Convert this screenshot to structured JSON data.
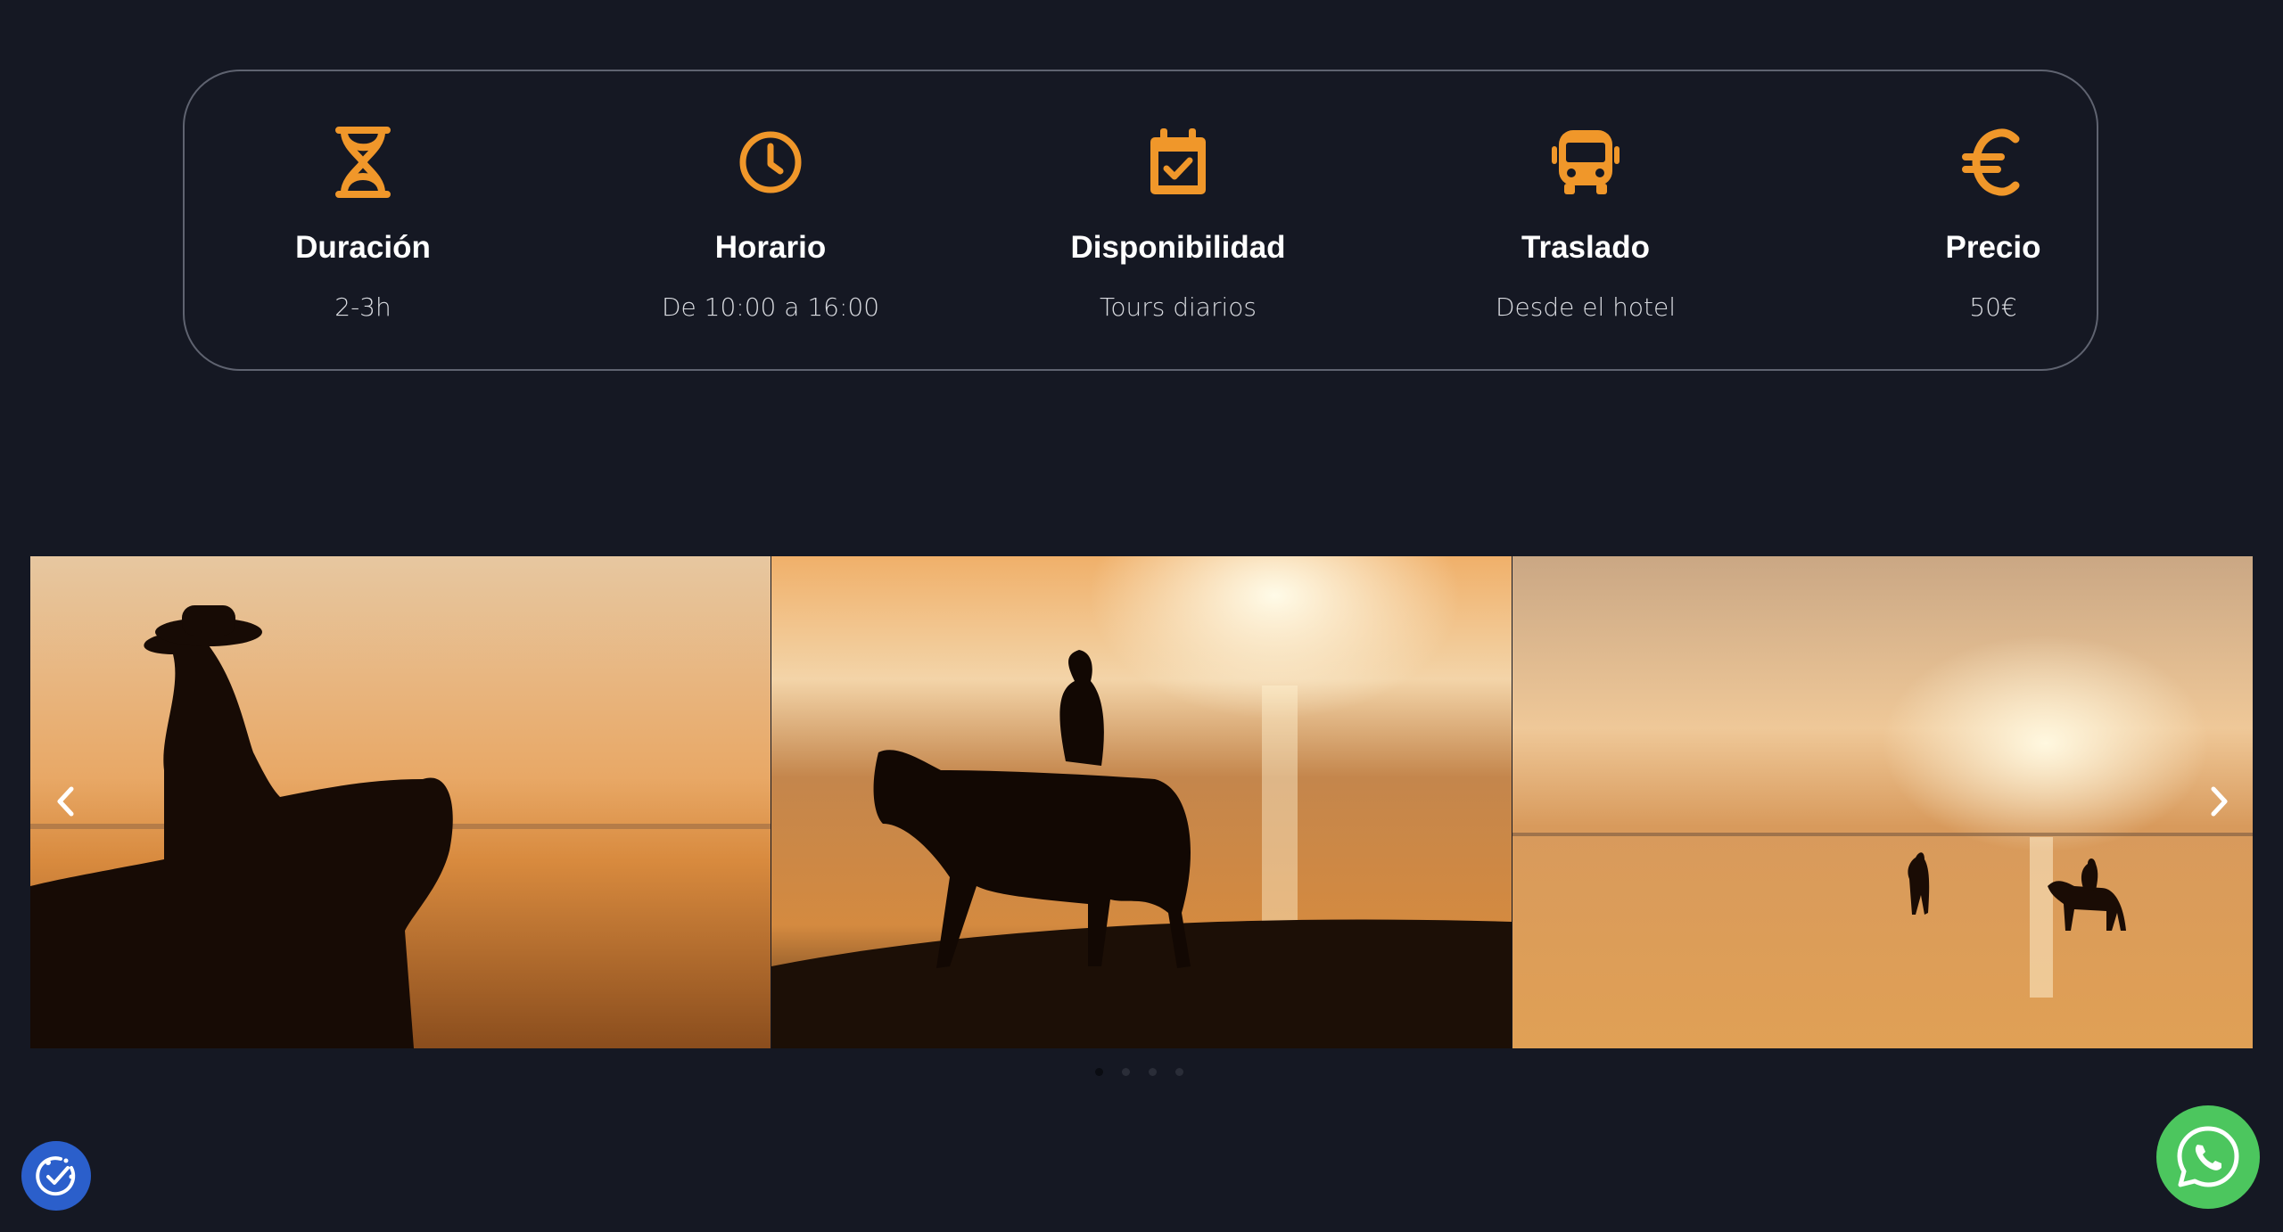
{
  "info": {
    "items": [
      {
        "icon": "hourglass-icon",
        "title": "Duración",
        "value": "2-3h"
      },
      {
        "icon": "clock-icon",
        "title": "Horario",
        "value": "De 10:00 a 16:00"
      },
      {
        "icon": "calendar-check-icon",
        "title": "Disponibilidad",
        "value": "Tours diarios"
      },
      {
        "icon": "bus-icon",
        "title": "Traslado",
        "value": "Desde el hotel"
      },
      {
        "icon": "euro-icon",
        "title": "Precio",
        "value": "50€"
      }
    ]
  },
  "carousel": {
    "slides": [
      {
        "image": "rider-with-hat-silhouette-sunset-beach"
      },
      {
        "image": "woman-riding-horse-silhouette-shoreline"
      },
      {
        "image": "distant-rider-and-walker-sunset-sea"
      }
    ],
    "dots_total": 4,
    "active_dot": 1,
    "prev_icon": "chevron-left-icon",
    "next_icon": "chevron-right-icon"
  },
  "floating": {
    "accessibility_icon": "accessibility-check-icon",
    "whatsapp_icon": "whatsapp-icon"
  },
  "colors": {
    "background": "#151823",
    "accent": "#f0972a",
    "card_border": "#5f6370",
    "whatsapp": "#4cc65e",
    "accessibility": "#2b5fcb"
  }
}
